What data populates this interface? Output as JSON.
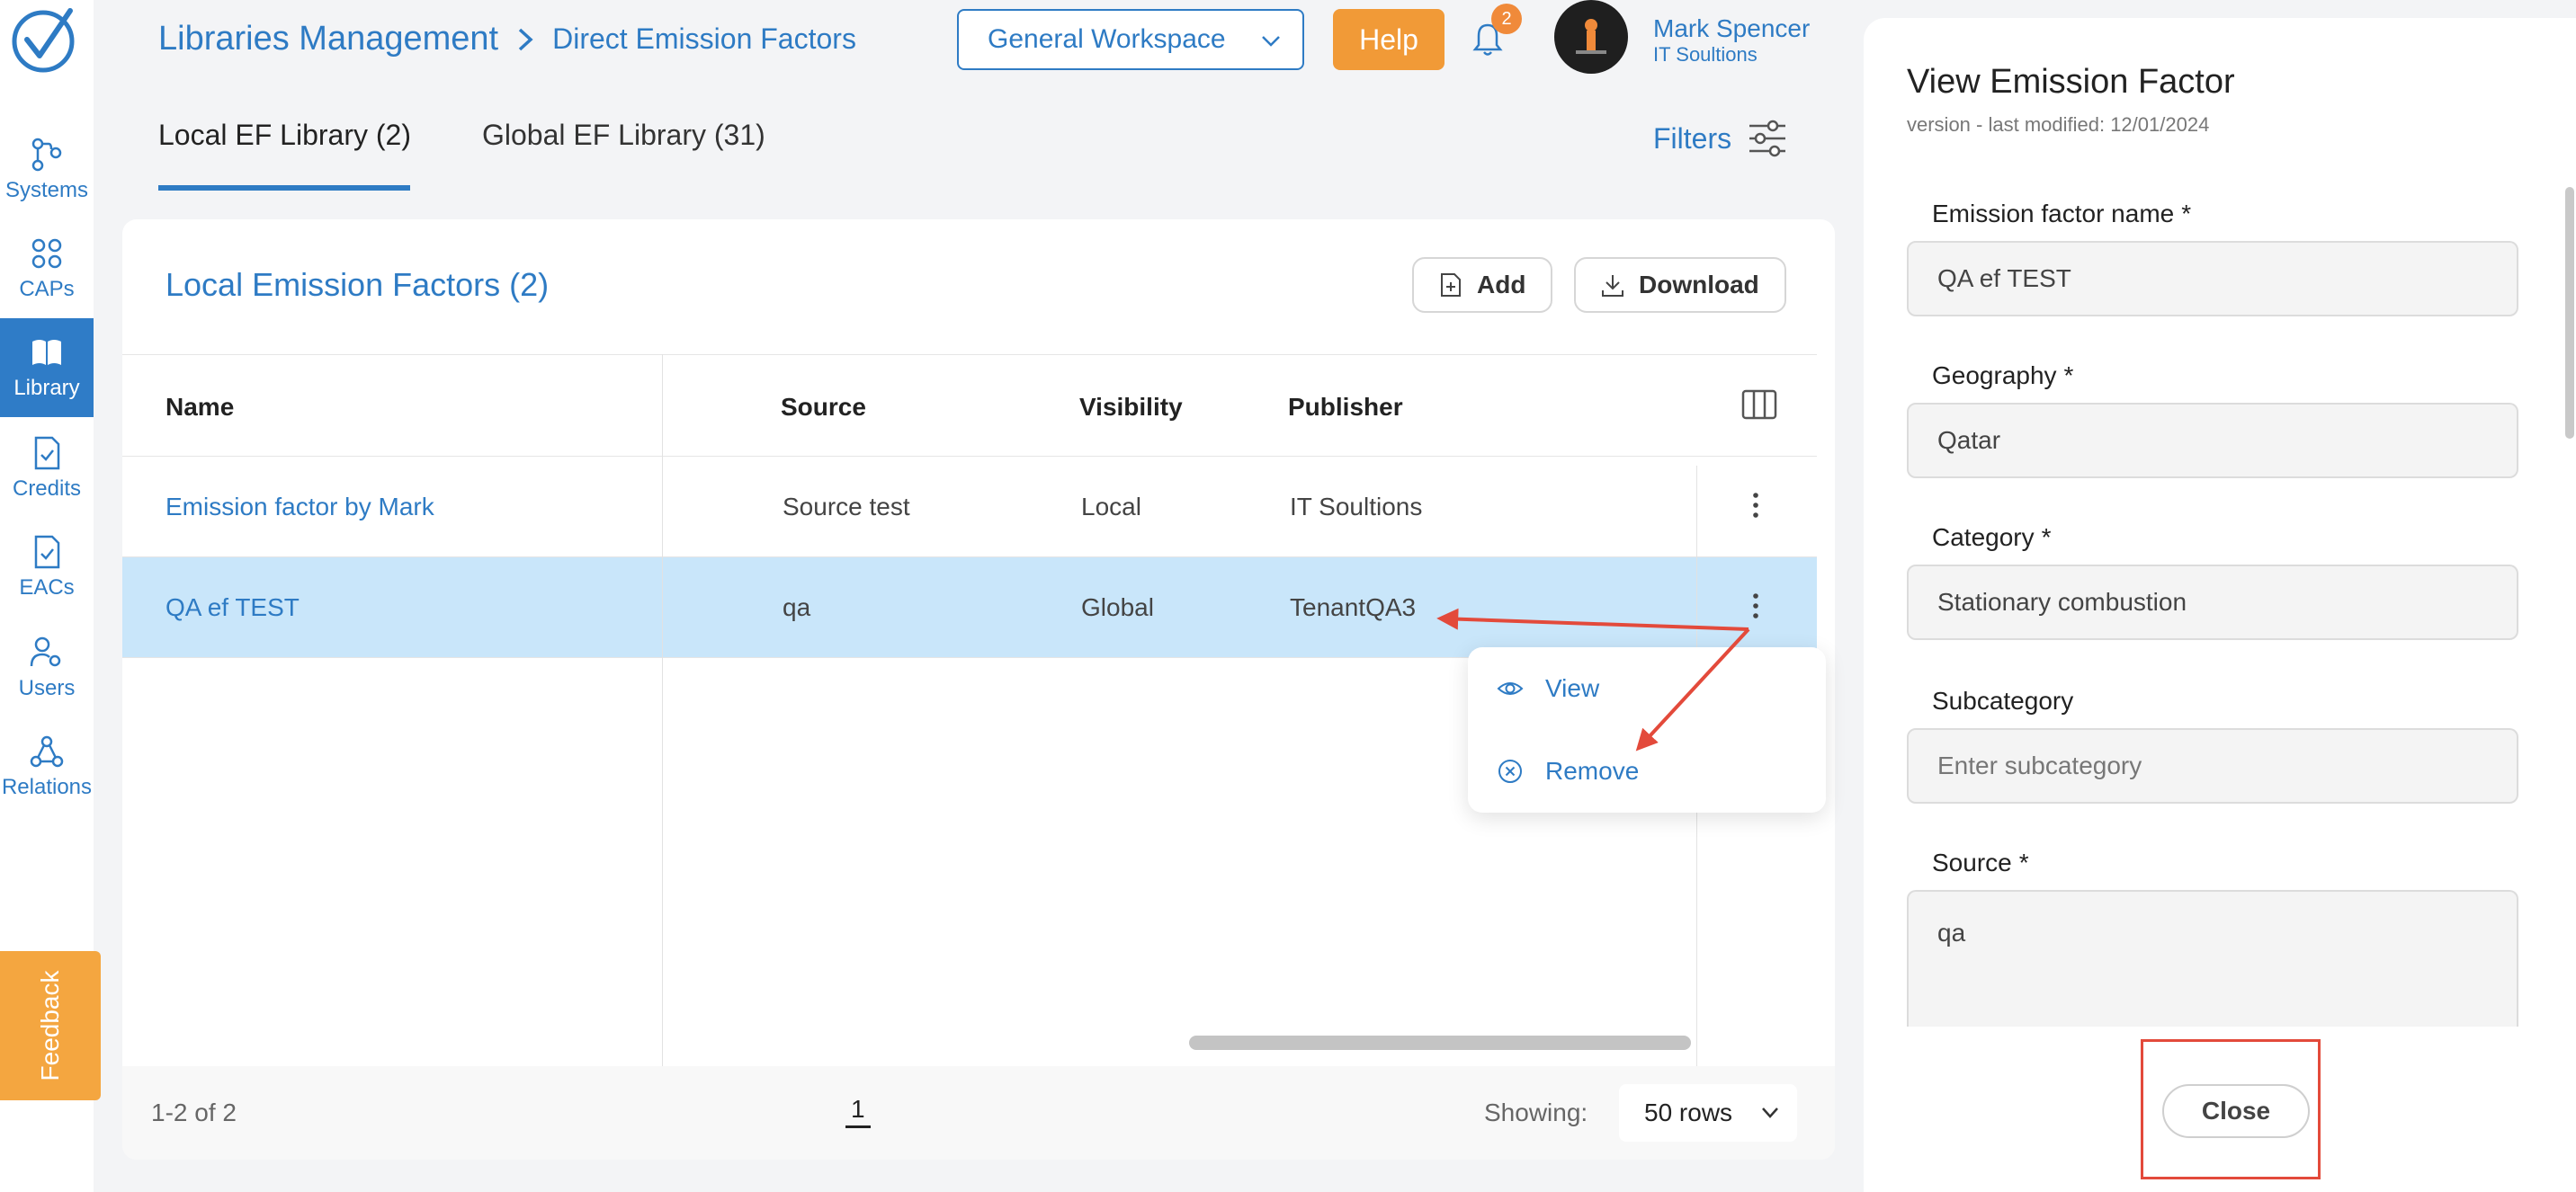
{
  "nav": {
    "items": [
      {
        "label": "Systems"
      },
      {
        "label": "CAPs"
      },
      {
        "label": "Library"
      },
      {
        "label": "Credits"
      },
      {
        "label": "EACs"
      },
      {
        "label": "Users"
      },
      {
        "label": "Relations"
      }
    ],
    "feedback": "Feedback"
  },
  "header": {
    "breadcrumb_main": "Libraries Management",
    "breadcrumb_sub": "Direct Emission Factors",
    "workspace": "General Workspace",
    "help": "Help",
    "notification_count": "2",
    "user_name": "Mark Spencer",
    "user_org": "IT Soultions"
  },
  "tabs": {
    "local": "Local EF Library (2)",
    "global": "Global EF Library (31)",
    "filters": "Filters"
  },
  "table": {
    "title": "Local Emission Factors (2)",
    "add": "Add",
    "download": "Download",
    "columns": {
      "name": "Name",
      "source": "Source",
      "visibility": "Visibility",
      "publisher": "Publisher"
    },
    "rows": [
      {
        "name": "Emission factor by Mark",
        "source": "Source test",
        "visibility": "Local",
        "publisher": "IT Soultions"
      },
      {
        "name": "QA ef TEST",
        "source": "qa",
        "visibility": "Global",
        "publisher": "TenantQA3"
      }
    ],
    "menu": {
      "view": "View",
      "remove": "Remove"
    },
    "footer": {
      "range": "1-2 of 2",
      "page": "1",
      "showing": "Showing:",
      "rows": "50 rows"
    }
  },
  "panel": {
    "title": "View Emission Factor",
    "subtitle": "version - last modified: 12/01/2024",
    "fields": {
      "name_label": "Emission factor name",
      "name_value": "QA ef TEST",
      "geo_label": "Geography",
      "geo_value": "Qatar",
      "category_label": "Category",
      "category_value": "Stationary combustion",
      "subcategory_label": "Subcategory",
      "subcategory_placeholder": "Enter subcategory",
      "source_label": "Source",
      "source_value": "qa"
    },
    "required_mark": "*",
    "close": "Close"
  },
  "colors": {
    "accent": "#2e7bc4",
    "help": "#f19a37",
    "feedback": "#f4a640",
    "selected_row": "#c9e6fa",
    "annotation": "#e34a3b"
  }
}
